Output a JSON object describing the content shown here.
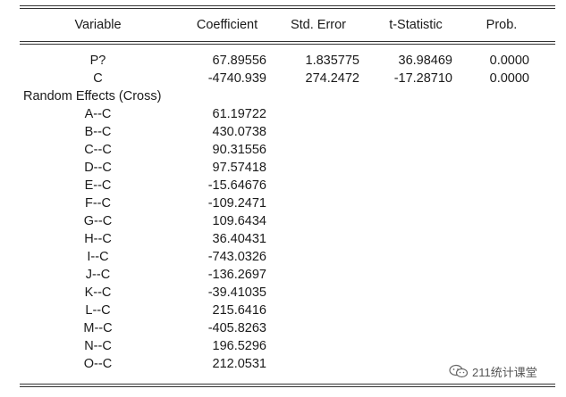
{
  "table": {
    "headers": {
      "variable": "Variable",
      "coefficient": "Coefficient",
      "std_error": "Std. Error",
      "t_statistic": "t-Statistic",
      "prob": "Prob."
    },
    "rows": [
      {
        "variable": "P?",
        "coefficient": "67.89556",
        "std_error": "1.835775",
        "t_statistic": "36.98469",
        "prob": "0.0000"
      },
      {
        "variable": "C",
        "coefficient": "-4740.939",
        "std_error": "274.2472",
        "t_statistic": "-17.28710",
        "prob": "0.0000"
      }
    ],
    "section_label": "Random Effects (Cross)",
    "effects": [
      {
        "variable": "A--C",
        "coefficient": "61.19722"
      },
      {
        "variable": "B--C",
        "coefficient": "430.0738"
      },
      {
        "variable": "C--C",
        "coefficient": "90.31556"
      },
      {
        "variable": "D--C",
        "coefficient": "97.57418"
      },
      {
        "variable": "E--C",
        "coefficient": "-15.64676"
      },
      {
        "variable": "F--C",
        "coefficient": "-109.2471"
      },
      {
        "variable": "G--C",
        "coefficient": "109.6434"
      },
      {
        "variable": "H--C",
        "coefficient": "36.40431"
      },
      {
        "variable": "I--C",
        "coefficient": "-743.0326"
      },
      {
        "variable": "J--C",
        "coefficient": "-136.2697"
      },
      {
        "variable": "K--C",
        "coefficient": "-39.41035"
      },
      {
        "variable": "L--C",
        "coefficient": "215.6416"
      },
      {
        "variable": "M--C",
        "coefficient": "-405.8263"
      },
      {
        "variable": "N--C",
        "coefficient": "196.5296"
      },
      {
        "variable": "O--C",
        "coefficient": "212.0531"
      }
    ]
  },
  "watermark": {
    "icon": "wechat-icon",
    "text": "211统计课堂"
  }
}
